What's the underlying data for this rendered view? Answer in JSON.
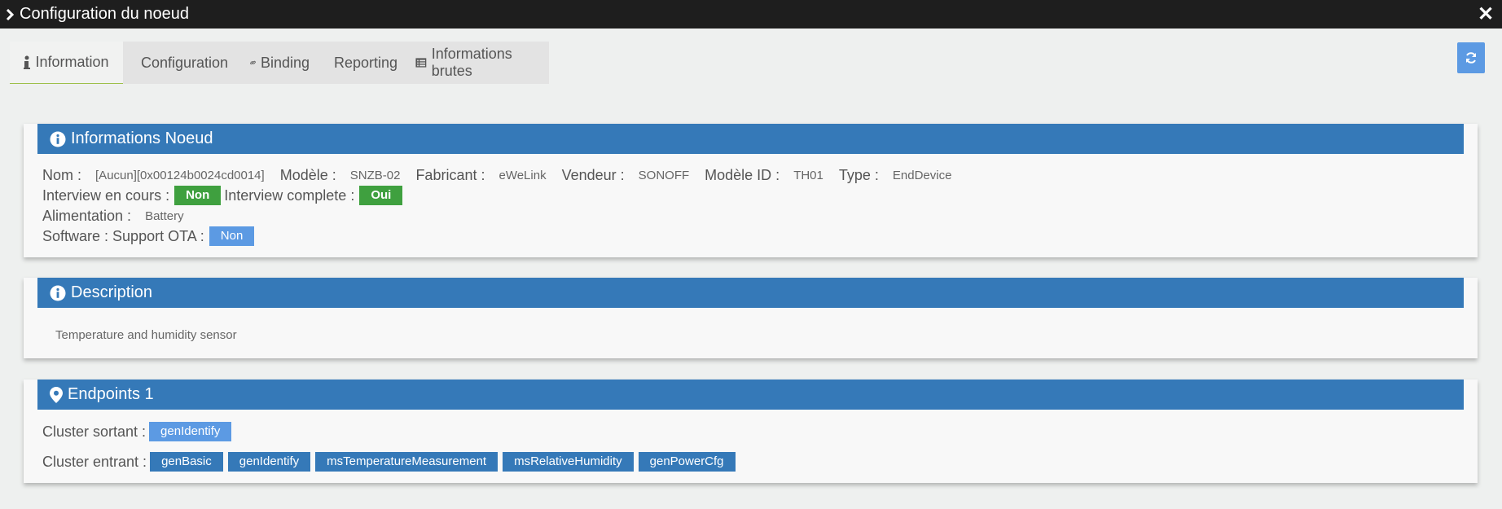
{
  "window": {
    "title": "Configuration du noeud",
    "close_icon": "close-icon"
  },
  "tabs": [
    {
      "label": "Information",
      "icon": "info-icon"
    },
    {
      "label": "Configuration",
      "icon": "info-icon"
    },
    {
      "label": "Binding",
      "icon": "link-icon"
    },
    {
      "label": "Reporting",
      "icon": "bars-icon"
    },
    {
      "label": "Informations brutes",
      "icon": "list-icon"
    }
  ],
  "refresh_icon": "refresh-icon",
  "info_panel": {
    "title": "Informations Noeud",
    "nom_label": "Nom :",
    "nom_value": "[Aucun][0x00124b0024cd0014]",
    "modele_label": "Modèle :",
    "modele_value": "SNZB-02",
    "fabricant_label": "Fabricant :",
    "fabricant_value": "eWeLink",
    "vendeur_label": "Vendeur :",
    "vendeur_value": "SONOFF",
    "modele_id_label": "Modèle ID :",
    "modele_id_value": "TH01",
    "type_label": "Type :",
    "type_value": "EndDevice",
    "interview_cours_label": "Interview en cours :",
    "interview_cours_value": "Non",
    "interview_complete_label": "Interview complete :",
    "interview_complete_value": "Oui",
    "alimentation_label": "Alimentation :",
    "alimentation_value": "Battery",
    "ota_label": "Software : Support OTA :",
    "ota_value": "Non"
  },
  "description_panel": {
    "title": "Description",
    "text": "Temperature and humidity sensor"
  },
  "endpoints_panel": {
    "title": "Endpoints 1",
    "sortant_label": "Cluster sortant :",
    "sortant": [
      "genIdentify"
    ],
    "entrant_label": "Cluster entrant :",
    "entrant": [
      "genBasic",
      "genIdentify",
      "msTemperatureMeasurement",
      "msRelativeHumidity",
      "genPowerCfg"
    ]
  },
  "colors": {
    "header": "#3579b8",
    "light_badge": "#5c9ae3",
    "green_badge": "#3fa03f",
    "titlebar": "#1e1e1e"
  }
}
